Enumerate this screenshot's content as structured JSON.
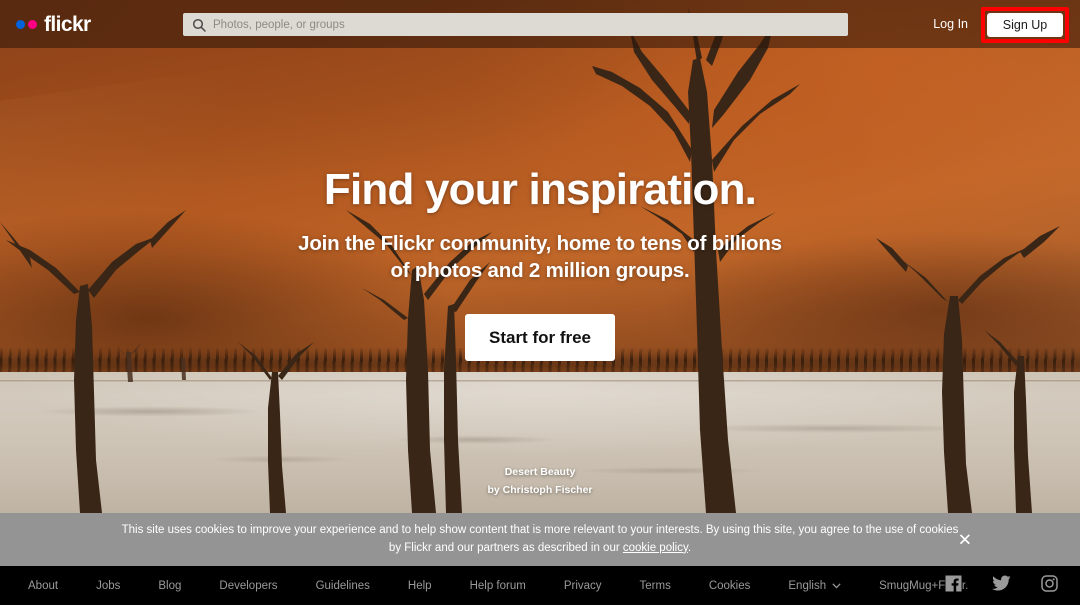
{
  "header": {
    "logo_word": "flickr",
    "logo_dots": [
      "dot-blue-icon",
      "dot-pink-icon"
    ],
    "search": {
      "icon": "search-icon",
      "placeholder": "Photos, people, or groups",
      "value": ""
    },
    "login_label": "Log In",
    "signup_label": "Sign Up",
    "highlight_color": "#ff0000"
  },
  "hero": {
    "title": "Find your inspiration.",
    "subtitle": "Join the Flickr community, home to tens of billions of photos and 2 million groups.",
    "cta_label": "Start for free",
    "credit_title": "Desert Beauty",
    "credit_author": "by Christoph Fischer"
  },
  "cookie": {
    "text_before": "This site uses cookies to improve your experience and to help show content that is more relevant to your interests. By using this site, you agree to the use of cookies by Flickr and our partners as described in our ",
    "link_label": "cookie policy",
    "text_after": ".",
    "close_icon": "close-icon",
    "close_glyph": "✕",
    "background": "#949494"
  },
  "footer": {
    "links": [
      {
        "label": "About"
      },
      {
        "label": "Jobs"
      },
      {
        "label": "Blog"
      },
      {
        "label": "Developers"
      },
      {
        "label": "Guidelines"
      },
      {
        "label": "Help"
      },
      {
        "label": "Help forum"
      },
      {
        "label": "Privacy"
      },
      {
        "label": "Terms"
      },
      {
        "label": "Cookies"
      }
    ],
    "language": "English",
    "smugmug_label": "SmugMug+Flickr.",
    "socials": [
      {
        "name": "facebook-icon"
      },
      {
        "name": "twitter-icon"
      },
      {
        "name": "instagram-icon"
      }
    ],
    "background": "#000000",
    "text_color": "#9a9a9a"
  }
}
